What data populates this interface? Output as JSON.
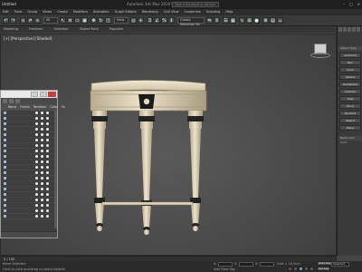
{
  "window": {
    "title": "Untitled",
    "center_title": "Autodesk 3ds Max 2016  Untitled",
    "search_placeholder": "Type a keyword or phrase",
    "controls": [
      "–",
      "□",
      "✕"
    ]
  },
  "menu": [
    "Edit",
    "Tools",
    "Group",
    "Views",
    "Create",
    "Modifiers",
    "Animation",
    "Graph Editors",
    "Rendering",
    "Civil View",
    "Customize",
    "Scripting",
    "Help"
  ],
  "toolbar": {
    "selection_filter": "All",
    "view_dropdown": "View",
    "named_selection": "Create Selection Se"
  },
  "ribbon_tabs": [
    "Modeling",
    "Freeform",
    "Selection",
    "Object Paint",
    "Populate"
  ],
  "viewport": {
    "label": "[+] [Perspective] [Shaded]"
  },
  "scene_explorer": {
    "columns": [
      "Name",
      "Frozen",
      "Renderer",
      "Color",
      "Sh"
    ],
    "row_count": 20
  },
  "command_panel": {
    "rollout_title": "Object Type",
    "buttons": [
      "AutoGrid",
      "Box",
      "Cone",
      "Sphere",
      "GeoSphere",
      "Cylinder",
      "Tube",
      "Torus",
      "Pyramid",
      "Teapot",
      "Plane"
    ],
    "section": "Name and Color"
  },
  "time_slider": {
    "label": "0 / 100"
  },
  "status": {
    "selected": "None Selected",
    "x_label": "X:",
    "y_label": "Y:",
    "z_label": "Z:",
    "grid": "Grid = 10,0cm",
    "auto_key": "Auto Key",
    "set_key": "Set Key",
    "selected_mode": "Selected",
    "add_time_tag": "Add Time Tag",
    "prompt": "Click or click-and-drag to select objects"
  }
}
